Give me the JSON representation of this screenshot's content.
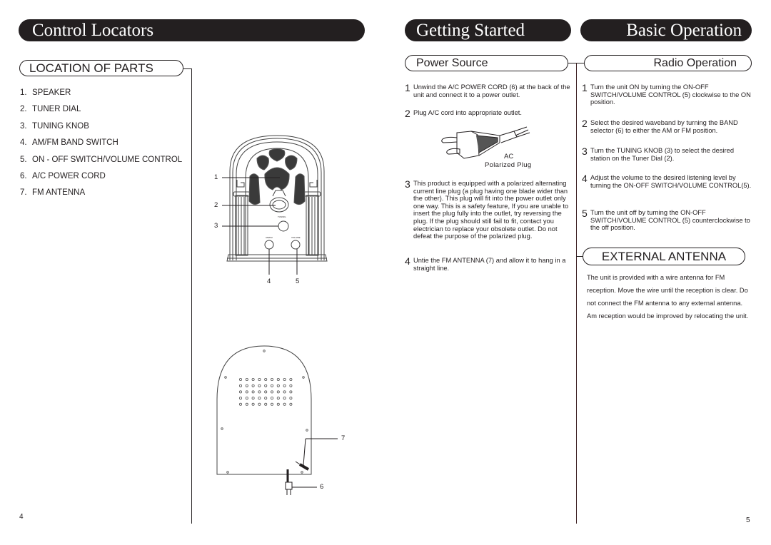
{
  "left_page": {
    "banner": "Control Locators",
    "section_title": "LOCATION OF PARTS",
    "parts": [
      {
        "num": "1.",
        "label": "SPEAKER"
      },
      {
        "num": "2.",
        "label": "TUNER DIAL"
      },
      {
        "num": "3.",
        "label": "TUNING KNOB"
      },
      {
        "num": "4.",
        "label": "AM/FM BAND SWITCH"
      },
      {
        "num": "5.",
        "label": "ON - OFF SWITCH/VOLUME CONTROL"
      },
      {
        "num": "6.",
        "label": "A/C POWER CORD"
      },
      {
        "num": "7.",
        "label": "FM ANTENNA"
      }
    ],
    "front_callouts": [
      "1",
      "2",
      "3",
      "4",
      "5"
    ],
    "front_knob_labels": {
      "tuning": "TUNING",
      "band": "AM/FM",
      "volume": "VOLUME",
      "on": "ON",
      "off": "OFF"
    },
    "back_callouts": [
      "7",
      "6"
    ],
    "page_number": "4"
  },
  "middle": {
    "banner": "Getting Started",
    "section_title": "Power Source",
    "steps": [
      {
        "num": "1",
        "text": "Unwind the A/C POWER CORD (6) at the back of the unit and connect it to a power outlet."
      },
      {
        "num": "2",
        "text": "Plug A/C cord into appropriate outlet."
      },
      {
        "num": "3",
        "text": "This product is equipped with a polarized alternating current line plug (a plug having one blade wider than the other). This plug will fit into the power outlet only one way. This is a safety feature, If you are unable to insert the plug fully into the outlet, try reversing the plug. If the plug should still fail to fit, contact you electrician to replace your obsolete outlet. Do not defeat the purpose of the polarized plug."
      },
      {
        "num": "4",
        "text": "Untie the FM ANTENNA (7) and allow it to hang in a straight line."
      }
    ],
    "plug_caption_line1": "AC",
    "plug_caption_line2": "Polarized Plug"
  },
  "right_page": {
    "banner": "Basic Operation",
    "section_title": "Radio Operation",
    "steps": [
      {
        "num": "1",
        "text": "Turn the unit ON by turning the ON-OFF SWITCH/VOLUME CONTROL (5) clockwise to the ON position."
      },
      {
        "num": "2",
        "text": "Select the desired waveband by turning the BAND selector (6) to either the AM or FM position."
      },
      {
        "num": "3",
        "text": "Turn the TUNING KNOB (3) to select the desired station on the Tuner Dial (2)."
      },
      {
        "num": "4",
        "text": "Adjust the volume to the desired listening level by turning the ON-OFF SWITCH/VOLUME CONTROL(5)."
      },
      {
        "num": "5",
        "text": "Turn the unit off by turning the ON-OFF SWITCH/VOLUME CONTROL (5) counterclockwise to the off position."
      }
    ],
    "external_title": "EXTERNAL ANTENNA",
    "external_text": "The unit is provided with a wire antenna for FM reception. Move the wire until the reception is clear. Do not connect the FM antenna to any external antenna. Am reception would be improved by relocating the unit.",
    "page_number": "5"
  }
}
